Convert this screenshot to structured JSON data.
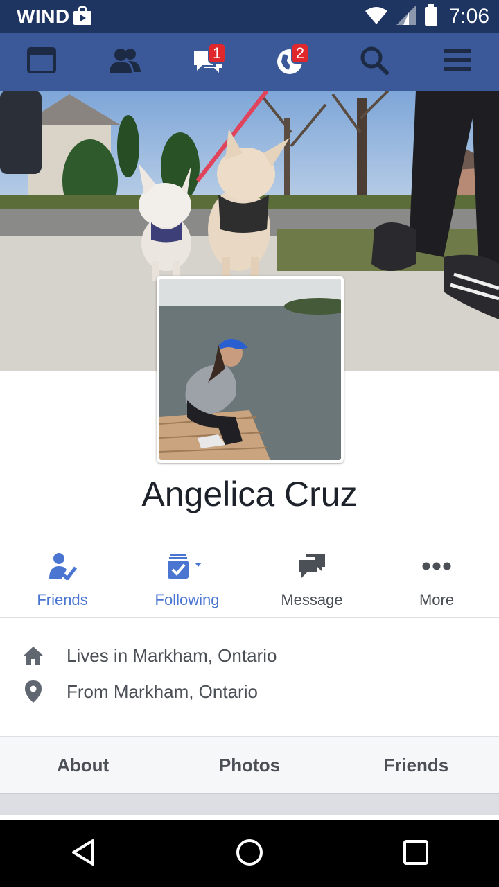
{
  "status_bar": {
    "carrier": "WIND",
    "time": "7:06"
  },
  "navbar": {
    "items": [
      {
        "icon": "news-feed-icon"
      },
      {
        "icon": "friend-requests-icon"
      },
      {
        "icon": "messages-icon",
        "badge": "1"
      },
      {
        "icon": "notifications-globe-icon",
        "badge": "2"
      },
      {
        "icon": "search-icon"
      },
      {
        "icon": "menu-icon"
      }
    ]
  },
  "profile": {
    "name": "Angelica Cruz"
  },
  "actions": [
    {
      "label": "Friends",
      "icon": "friends-check-icon",
      "color": "#4a76d2"
    },
    {
      "label": "Following",
      "icon": "following-icon",
      "color": "#4a76d2"
    },
    {
      "label": "Message",
      "icon": "message-icon",
      "color": "#4b4f56"
    },
    {
      "label": "More",
      "icon": "more-dots-icon",
      "color": "#4b4f56"
    }
  ],
  "info": [
    {
      "icon": "home-icon",
      "text": "Lives in Markham, Ontario"
    },
    {
      "icon": "location-pin-icon",
      "text": "From Markham, Ontario"
    }
  ],
  "tabs": [
    {
      "label": "About"
    },
    {
      "label": "Photos"
    },
    {
      "label": "Friends"
    }
  ],
  "colors": {
    "status_bar": "#1e3461",
    "navbar": "#3b5998",
    "badge": "#e0282c",
    "accent_blue": "#4a76d2"
  }
}
